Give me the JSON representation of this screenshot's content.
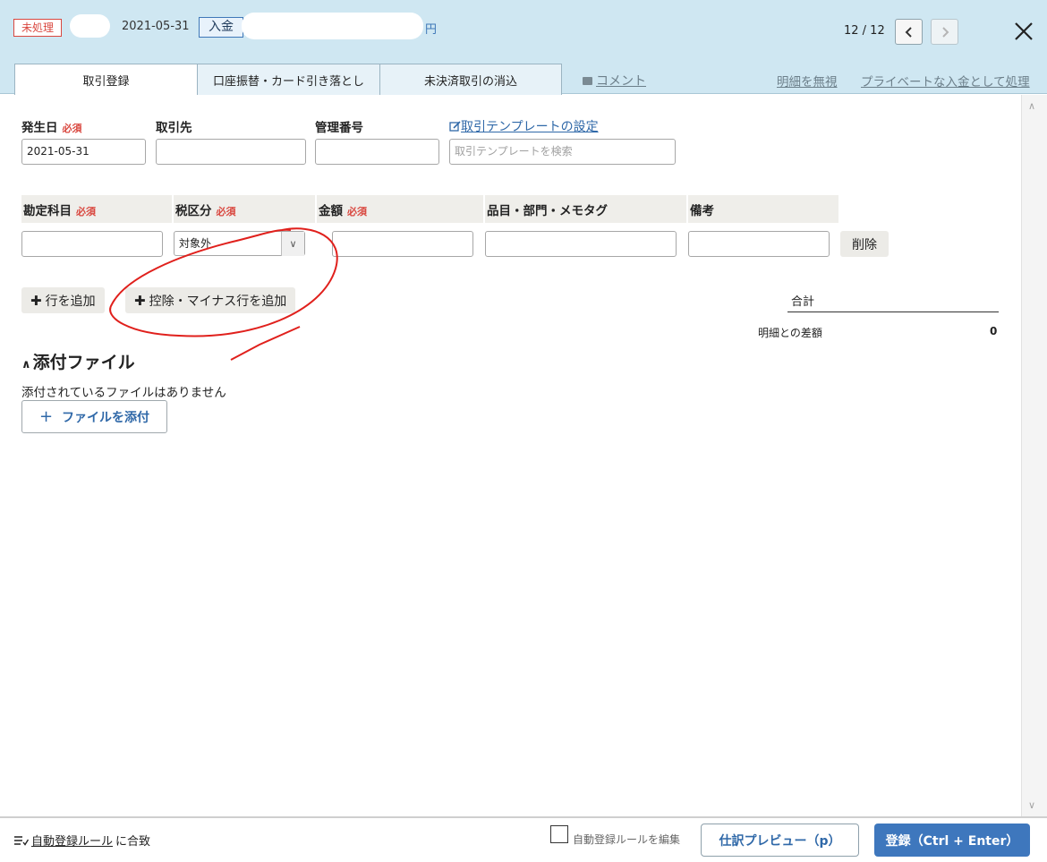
{
  "header": {
    "status_badge": "未処理",
    "date": "2021-05-31",
    "type_badge": "入金",
    "amount_suffix": "円",
    "pager": "12 / 12"
  },
  "tabs": [
    {
      "label": "取引登録"
    },
    {
      "label": "口座振替・カード引き落とし"
    },
    {
      "label": "未決済取引の消込"
    }
  ],
  "header_links": {
    "comment": "コメント",
    "ignore": "明細を無視",
    "private": "プライベートな入金として処理"
  },
  "form": {
    "date_label": "発生日",
    "required": "必須",
    "date_value": "2021-05-31",
    "partner_label": "取引先",
    "ref_label": "管理番号",
    "template_link": "取引テンプレートの設定",
    "template_placeholder": "取引テンプレートを検索"
  },
  "table": {
    "columns": [
      "勘定科目",
      "税区分",
      "金額",
      "品目・部門・メモタグ",
      "備考"
    ],
    "tax_value": "対象外",
    "delete_label": "削除"
  },
  "actions": {
    "add_row": "行を追加",
    "add_deduction_row": "控除・マイナス行を追加"
  },
  "summary": {
    "total_label": "合計",
    "diff_label": "明細との差額",
    "diff_value": "0"
  },
  "attachments": {
    "title": "添付ファイル",
    "empty_text": "添付されているファイルはありません",
    "attach_button": "ファイルを添付"
  },
  "footer": {
    "rule_link": "自動登録ルール",
    "rule_suffix": "に合致",
    "edit_rule_label": "自動登録ルールを編集",
    "preview_button": "仕訳プレビュー（p）",
    "submit_button": "登録（Ctrl + Enter）"
  },
  "colors": {
    "header_bg": "#cfe7f2",
    "accent": "#3e77bd",
    "required": "#d9473f",
    "annotation": "#e0201c"
  },
  "icons": [
    "chevron-left-icon",
    "chevron-right-icon",
    "close-icon",
    "comment-icon",
    "edit-icon",
    "chevron-down-icon",
    "plus-icon",
    "chevron-up-icon",
    "rule-list-icon"
  ]
}
